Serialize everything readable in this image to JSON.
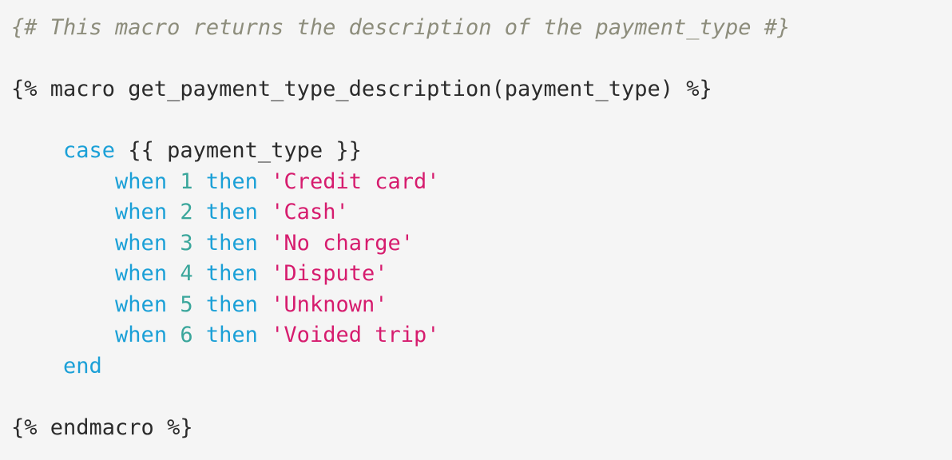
{
  "editor": {
    "language": "jinja-sql",
    "background_color": "#f5f5f5",
    "colors": {
      "plain": "#2b2b2b",
      "comment": "#8d8d7c",
      "keyword": "#1ba0d7",
      "number": "#3aa69b",
      "string": "#d61c6e"
    }
  },
  "code": {
    "lines": [
      {
        "indent": "",
        "tokens": [
          {
            "type": "comment",
            "text": "{# This macro returns the description of the payment_type #}"
          }
        ]
      },
      {
        "indent": "",
        "tokens": []
      },
      {
        "indent": "",
        "tokens": [
          {
            "type": "plain",
            "text": "{% macro get_payment_type_description(payment_type) %}"
          }
        ]
      },
      {
        "indent": "",
        "tokens": []
      },
      {
        "indent": "    ",
        "tokens": [
          {
            "type": "keyword",
            "text": "case"
          },
          {
            "type": "plain",
            "text": " {{ payment_type }}"
          }
        ]
      },
      {
        "indent": "        ",
        "tokens": [
          {
            "type": "keyword",
            "text": "when"
          },
          {
            "type": "plain",
            "text": " "
          },
          {
            "type": "number",
            "text": "1"
          },
          {
            "type": "plain",
            "text": " "
          },
          {
            "type": "keyword",
            "text": "then"
          },
          {
            "type": "plain",
            "text": " "
          },
          {
            "type": "string",
            "text": "'Credit card'"
          }
        ]
      },
      {
        "indent": "        ",
        "tokens": [
          {
            "type": "keyword",
            "text": "when"
          },
          {
            "type": "plain",
            "text": " "
          },
          {
            "type": "number",
            "text": "2"
          },
          {
            "type": "plain",
            "text": " "
          },
          {
            "type": "keyword",
            "text": "then"
          },
          {
            "type": "plain",
            "text": " "
          },
          {
            "type": "string",
            "text": "'Cash'"
          }
        ]
      },
      {
        "indent": "        ",
        "tokens": [
          {
            "type": "keyword",
            "text": "when"
          },
          {
            "type": "plain",
            "text": " "
          },
          {
            "type": "number",
            "text": "3"
          },
          {
            "type": "plain",
            "text": " "
          },
          {
            "type": "keyword",
            "text": "then"
          },
          {
            "type": "plain",
            "text": " "
          },
          {
            "type": "string",
            "text": "'No charge'"
          }
        ]
      },
      {
        "indent": "        ",
        "tokens": [
          {
            "type": "keyword",
            "text": "when"
          },
          {
            "type": "plain",
            "text": " "
          },
          {
            "type": "number",
            "text": "4"
          },
          {
            "type": "plain",
            "text": " "
          },
          {
            "type": "keyword",
            "text": "then"
          },
          {
            "type": "plain",
            "text": " "
          },
          {
            "type": "string",
            "text": "'Dispute'"
          }
        ]
      },
      {
        "indent": "        ",
        "tokens": [
          {
            "type": "keyword",
            "text": "when"
          },
          {
            "type": "plain",
            "text": " "
          },
          {
            "type": "number",
            "text": "5"
          },
          {
            "type": "plain",
            "text": " "
          },
          {
            "type": "keyword",
            "text": "then"
          },
          {
            "type": "plain",
            "text": " "
          },
          {
            "type": "string",
            "text": "'Unknown'"
          }
        ]
      },
      {
        "indent": "        ",
        "tokens": [
          {
            "type": "keyword",
            "text": "when"
          },
          {
            "type": "plain",
            "text": " "
          },
          {
            "type": "number",
            "text": "6"
          },
          {
            "type": "plain",
            "text": " "
          },
          {
            "type": "keyword",
            "text": "then"
          },
          {
            "type": "plain",
            "text": " "
          },
          {
            "type": "string",
            "text": "'Voided trip'"
          }
        ]
      },
      {
        "indent": "    ",
        "tokens": [
          {
            "type": "keyword",
            "text": "end"
          }
        ]
      },
      {
        "indent": "",
        "tokens": []
      },
      {
        "indent": "",
        "tokens": [
          {
            "type": "plain",
            "text": "{% endmacro %}"
          }
        ]
      }
    ]
  }
}
